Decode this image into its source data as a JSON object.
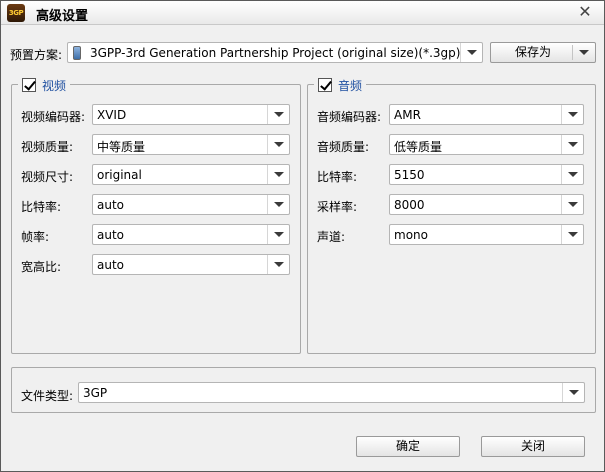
{
  "window": {
    "title": "高级设置",
    "app_icon_text": "3GP"
  },
  "preset": {
    "label": "预置方案:",
    "value": "3GPP-3rd Generation Partnership Project (original size)(*.3gp)",
    "save_as_label": "保存为"
  },
  "video": {
    "title": "视频",
    "checked": true,
    "fields": [
      {
        "label": "视频编码器:",
        "value": "XVID"
      },
      {
        "label": "视频质量:",
        "value": "中等质量"
      },
      {
        "label": "视频尺寸:",
        "value": "original"
      },
      {
        "label": "比特率:",
        "value": "auto"
      },
      {
        "label": "帧率:",
        "value": "auto"
      },
      {
        "label": "宽高比:",
        "value": "auto"
      }
    ]
  },
  "audio": {
    "title": "音频",
    "checked": true,
    "fields": [
      {
        "label": "音频编码器:",
        "value": "AMR"
      },
      {
        "label": "音频质量:",
        "value": "低等质量"
      },
      {
        "label": "比特率:",
        "value": "5150"
      },
      {
        "label": "采样率:",
        "value": "8000"
      },
      {
        "label": "声道:",
        "value": "mono"
      }
    ]
  },
  "filetype": {
    "label": "文件类型:",
    "value": "3GP"
  },
  "buttons": {
    "ok": "确定",
    "close": "关闭"
  }
}
